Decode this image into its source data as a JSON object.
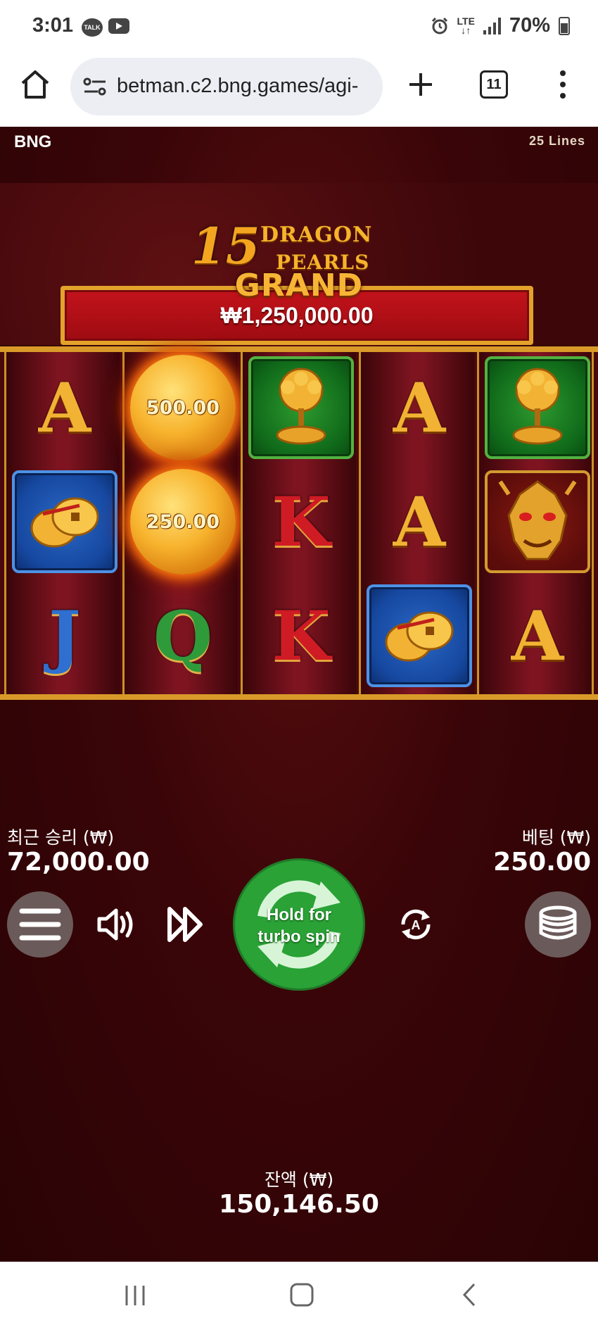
{
  "status": {
    "time": "3:01",
    "network": "LTE",
    "battery": "70%"
  },
  "browser": {
    "url": "betman.c2.bng.games/agi-",
    "tab_count": "11"
  },
  "game": {
    "brand": "BNG",
    "lines": "25 Lines",
    "logo": {
      "number": "15",
      "line1": "DRAGON",
      "line2": "PEARLS"
    },
    "jackpot": {
      "title": "GRAND",
      "value": "₩1,250,000.00"
    },
    "reels": [
      [
        "A",
        "coins",
        "J"
      ],
      [
        "pearl:500.00",
        "pearl:250.00",
        "Q"
      ],
      [
        "tree",
        "K",
        "K"
      ],
      [
        "A",
        "A",
        "coins"
      ],
      [
        "tree",
        "dragon",
        "A"
      ]
    ],
    "pearl_values": [
      "500.00",
      "250.00"
    ],
    "last_win": {
      "label": "최근 승리 (₩)",
      "value": "72,000.00"
    },
    "bet": {
      "label": "베팅 (₩)",
      "value": "250.00"
    },
    "spin": {
      "line1": "Hold for",
      "line2": "turbo spin"
    },
    "balance": {
      "label": "잔액 (₩)",
      "value": "150,146.50"
    },
    "colors": {
      "spin_green": "#2aa236",
      "gold": "#f2b233",
      "jackpot_red": "#c3131b"
    }
  }
}
